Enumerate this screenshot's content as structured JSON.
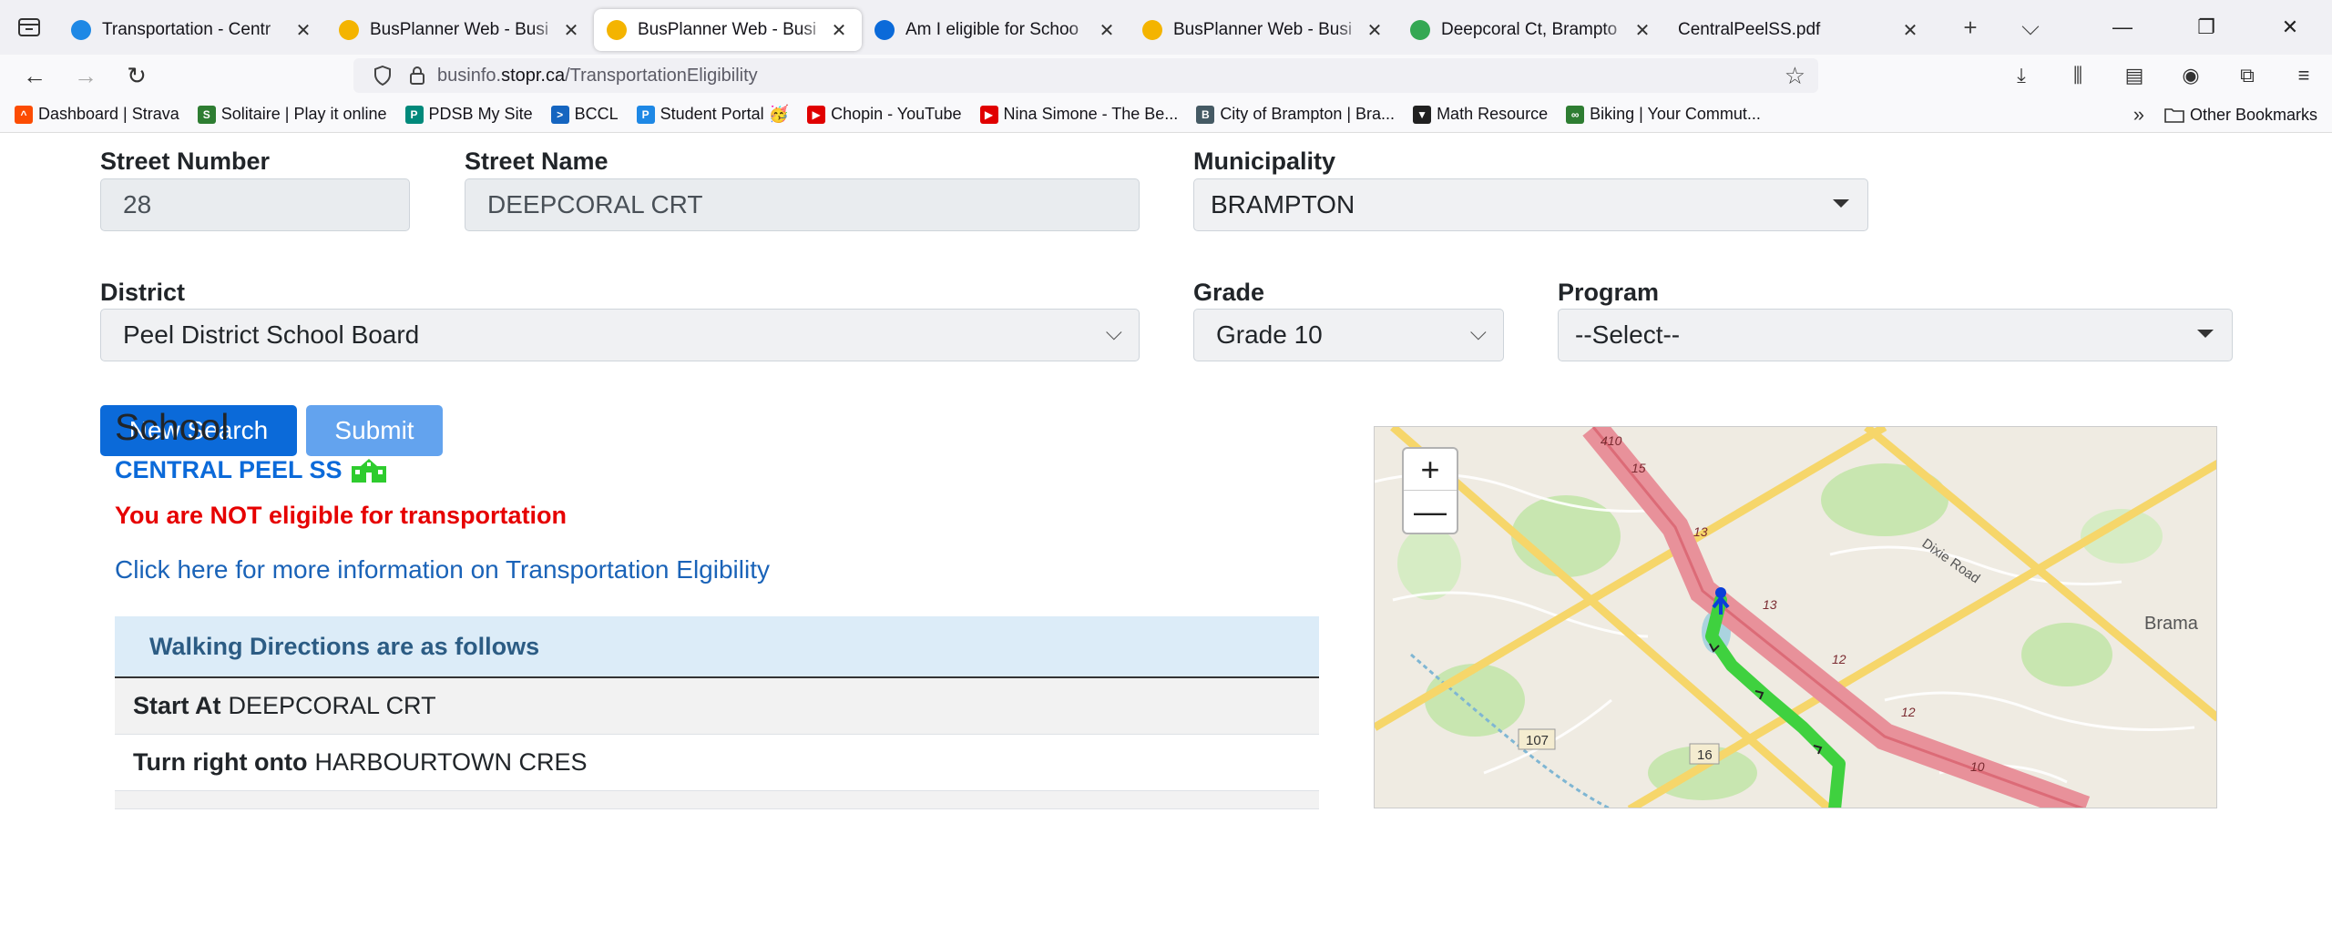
{
  "browser": {
    "tabs": [
      {
        "title": "Transportation - Centr",
        "icon": "stopr-icon",
        "color": "#1e88e5",
        "active": false
      },
      {
        "title": "BusPlanner Web - Busi",
        "icon": "busplanner-icon",
        "color": "#f4b400",
        "active": false
      },
      {
        "title": "BusPlanner Web - Busi",
        "icon": "busplanner-icon",
        "color": "#f4b400",
        "active": true
      },
      {
        "title": "Am I eligible for Schoo",
        "icon": "sharepoint-icon",
        "color": "#0b6ad9",
        "active": false
      },
      {
        "title": "BusPlanner Web - Busi",
        "icon": "busplanner-icon",
        "color": "#f4b400",
        "active": false
      },
      {
        "title": "Deepcoral Ct, Brampto",
        "icon": "maps-pin-icon",
        "color": "#34a853",
        "active": false
      },
      {
        "title": "CentralPeelSS.pdf",
        "icon": "",
        "color": "",
        "active": false
      }
    ],
    "url": {
      "prefix": "businfo.",
      "host": "stopr.ca",
      "path": "/TransportationEligibility"
    },
    "bookmarks": [
      {
        "label": "Dashboard | Strava",
        "color": "#fc4c02",
        "glyph": "^"
      },
      {
        "label": "Solitaire | Play it online",
        "color": "#2e7d32",
        "glyph": "S"
      },
      {
        "label": "PDSB My Site",
        "color": "#00897b",
        "glyph": "P"
      },
      {
        "label": "BCCL",
        "color": "#1565c0",
        "glyph": ">"
      },
      {
        "label": "Student Portal 🥳",
        "color": "#1e88e5",
        "glyph": "P"
      },
      {
        "label": "Chopin - YouTube",
        "color": "#e00000",
        "glyph": "▶"
      },
      {
        "label": "Nina Simone - The Be...",
        "color": "#e00000",
        "glyph": "▶"
      },
      {
        "label": "City of Brampton | Bra...",
        "color": "#455a64",
        "glyph": "B"
      },
      {
        "label": "Math Resource",
        "color": "#212121",
        "glyph": "▼"
      },
      {
        "label": "Biking | Your Commut...",
        "color": "#2e7d32",
        "glyph": "∞"
      }
    ],
    "other_bookmarks": "Other Bookmarks"
  },
  "form": {
    "street_number": {
      "label": "Street Number",
      "value": "28"
    },
    "street_name": {
      "label": "Street Name",
      "value": "DEEPCORAL CRT"
    },
    "municipality": {
      "label": "Municipality",
      "value": "BRAMPTON"
    },
    "district": {
      "label": "District",
      "value": "Peel District School Board"
    },
    "grade": {
      "label": "Grade",
      "value": "Grade 10"
    },
    "program": {
      "label": "Program",
      "value": "--Select--"
    },
    "new_search_label": "New Search",
    "submit_label": "Submit"
  },
  "result": {
    "heading": "School",
    "school_name": "CENTRAL PEEL SS",
    "eligibility": "You are NOT eligible for transportation",
    "info_link": "Click here for more information on Transportation Elgibility",
    "directions_header": "Walking Directions are as follows",
    "directions": [
      {
        "action": "Start At",
        "street": "DEEPCORAL CRT"
      },
      {
        "action": "Turn right onto",
        "street": "HARBOURTOWN CRES"
      }
    ]
  },
  "map": {
    "zoom_in": "+",
    "zoom_out": "—",
    "labels": {
      "road_dixie": "Dixie Road",
      "place_brampton": "Brama",
      "hwy_410": "410",
      "num_15": "15",
      "num_13a": "13",
      "num_13b": "13",
      "num_12a": "12",
      "num_12b": "12",
      "num_10": "10",
      "shield_107": "107",
      "shield_16": "16"
    }
  }
}
